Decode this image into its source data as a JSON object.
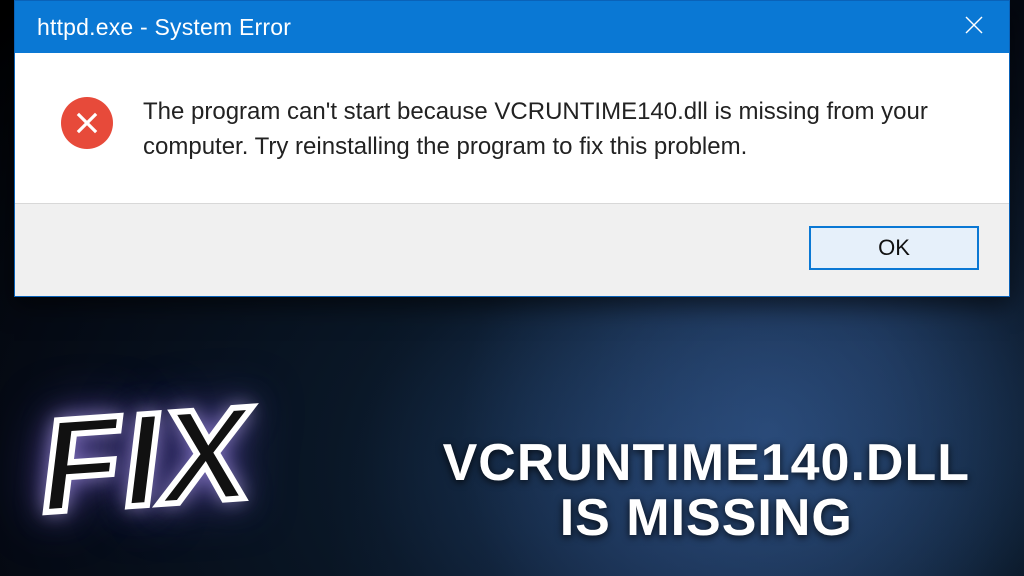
{
  "dialog": {
    "title": "httpd.exe - System Error",
    "message": "The program can't start because VCRUNTIME140.dll is missing from your computer. Try reinstalling the program to fix this problem.",
    "ok_label": "OK"
  },
  "overlay": {
    "fix_text": "FIX",
    "caption_line1": "VCRUNTIME140.DLL",
    "caption_line2": "IS MISSING"
  },
  "colors": {
    "titlebar": "#0a78d4",
    "error_icon": "#e74a3a"
  }
}
